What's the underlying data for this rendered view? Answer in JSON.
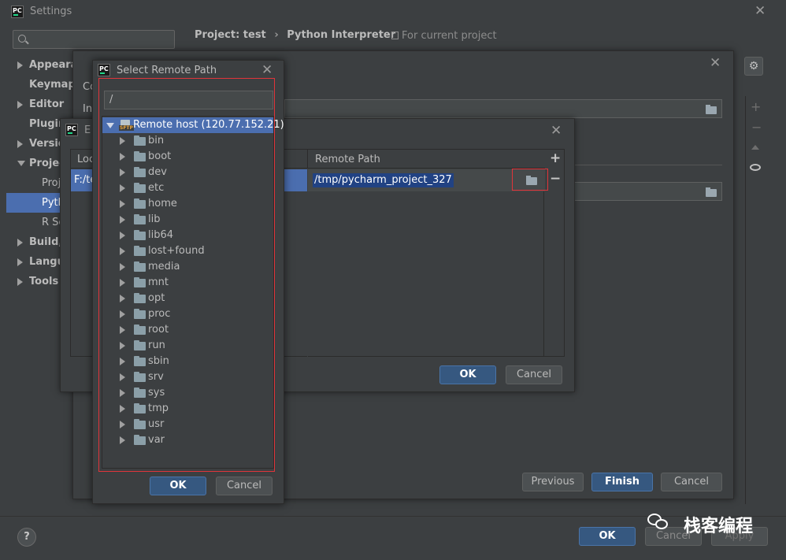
{
  "settings": {
    "title": "Settings",
    "breadcrumb_project": "Project: test",
    "breadcrumb_separator": "›",
    "breadcrumb_page": "Python Interpreter",
    "scope_note": "For current project",
    "search_placeholder": "",
    "sidebar": [
      {
        "label": "Appearar",
        "arrow": "right"
      },
      {
        "label": "Keymap",
        "arrow": "none"
      },
      {
        "label": "Editor",
        "arrow": "right"
      },
      {
        "label": "Plugin",
        "arrow": "none"
      },
      {
        "label": "Versio",
        "arrow": "right"
      },
      {
        "label": "Projec",
        "arrow": "down"
      },
      {
        "label": "Proj",
        "arrow": "sub"
      },
      {
        "label": "Pyth",
        "arrow": "sub-selected"
      },
      {
        "label": "R Se",
        "arrow": "sub"
      },
      {
        "label": "Build,",
        "arrow": "right"
      },
      {
        "label": "Langu",
        "arrow": "right"
      },
      {
        "label": "Tools",
        "arrow": "right"
      }
    ],
    "ok_label": "OK",
    "cancel_label": "Cancel",
    "apply_label": "Apply",
    "help_label": "?"
  },
  "add_interpreter": {
    "title_fragment_1": "Co",
    "title_fragment_2": "In",
    "previous_label": "Previous",
    "finish_label": "Finish",
    "cancel_label": "Cancel"
  },
  "edit_mappings": {
    "title_fragment": "E",
    "col_local": "Loc",
    "col_remote": "Remote Path",
    "local_value": "F:/te",
    "remote_value": "/tmp/pycharm_project_327",
    "add_label": "+",
    "remove_label": "−",
    "ok_label": "OK",
    "cancel_label": "Cancel"
  },
  "select_remote": {
    "title": "Select Remote Path",
    "path_value": "/",
    "root_label": "Remote host (120.77.152.21)",
    "root_icon_text": "SFTP",
    "folders": [
      "bin",
      "boot",
      "dev",
      "etc",
      "home",
      "lib",
      "lib64",
      "lost+found",
      "media",
      "mnt",
      "opt",
      "proc",
      "root",
      "run",
      "sbin",
      "srv",
      "sys",
      "tmp",
      "usr",
      "var"
    ],
    "ok_label": "OK",
    "cancel_label": "Cancel"
  },
  "watermark": {
    "text": "栈客编程"
  },
  "logo_text": "PC",
  "colors": {
    "background": "#3c3f41",
    "selection": "#4b6eaf",
    "primary_button": "#365880",
    "highlight_border": "#e0343a"
  }
}
